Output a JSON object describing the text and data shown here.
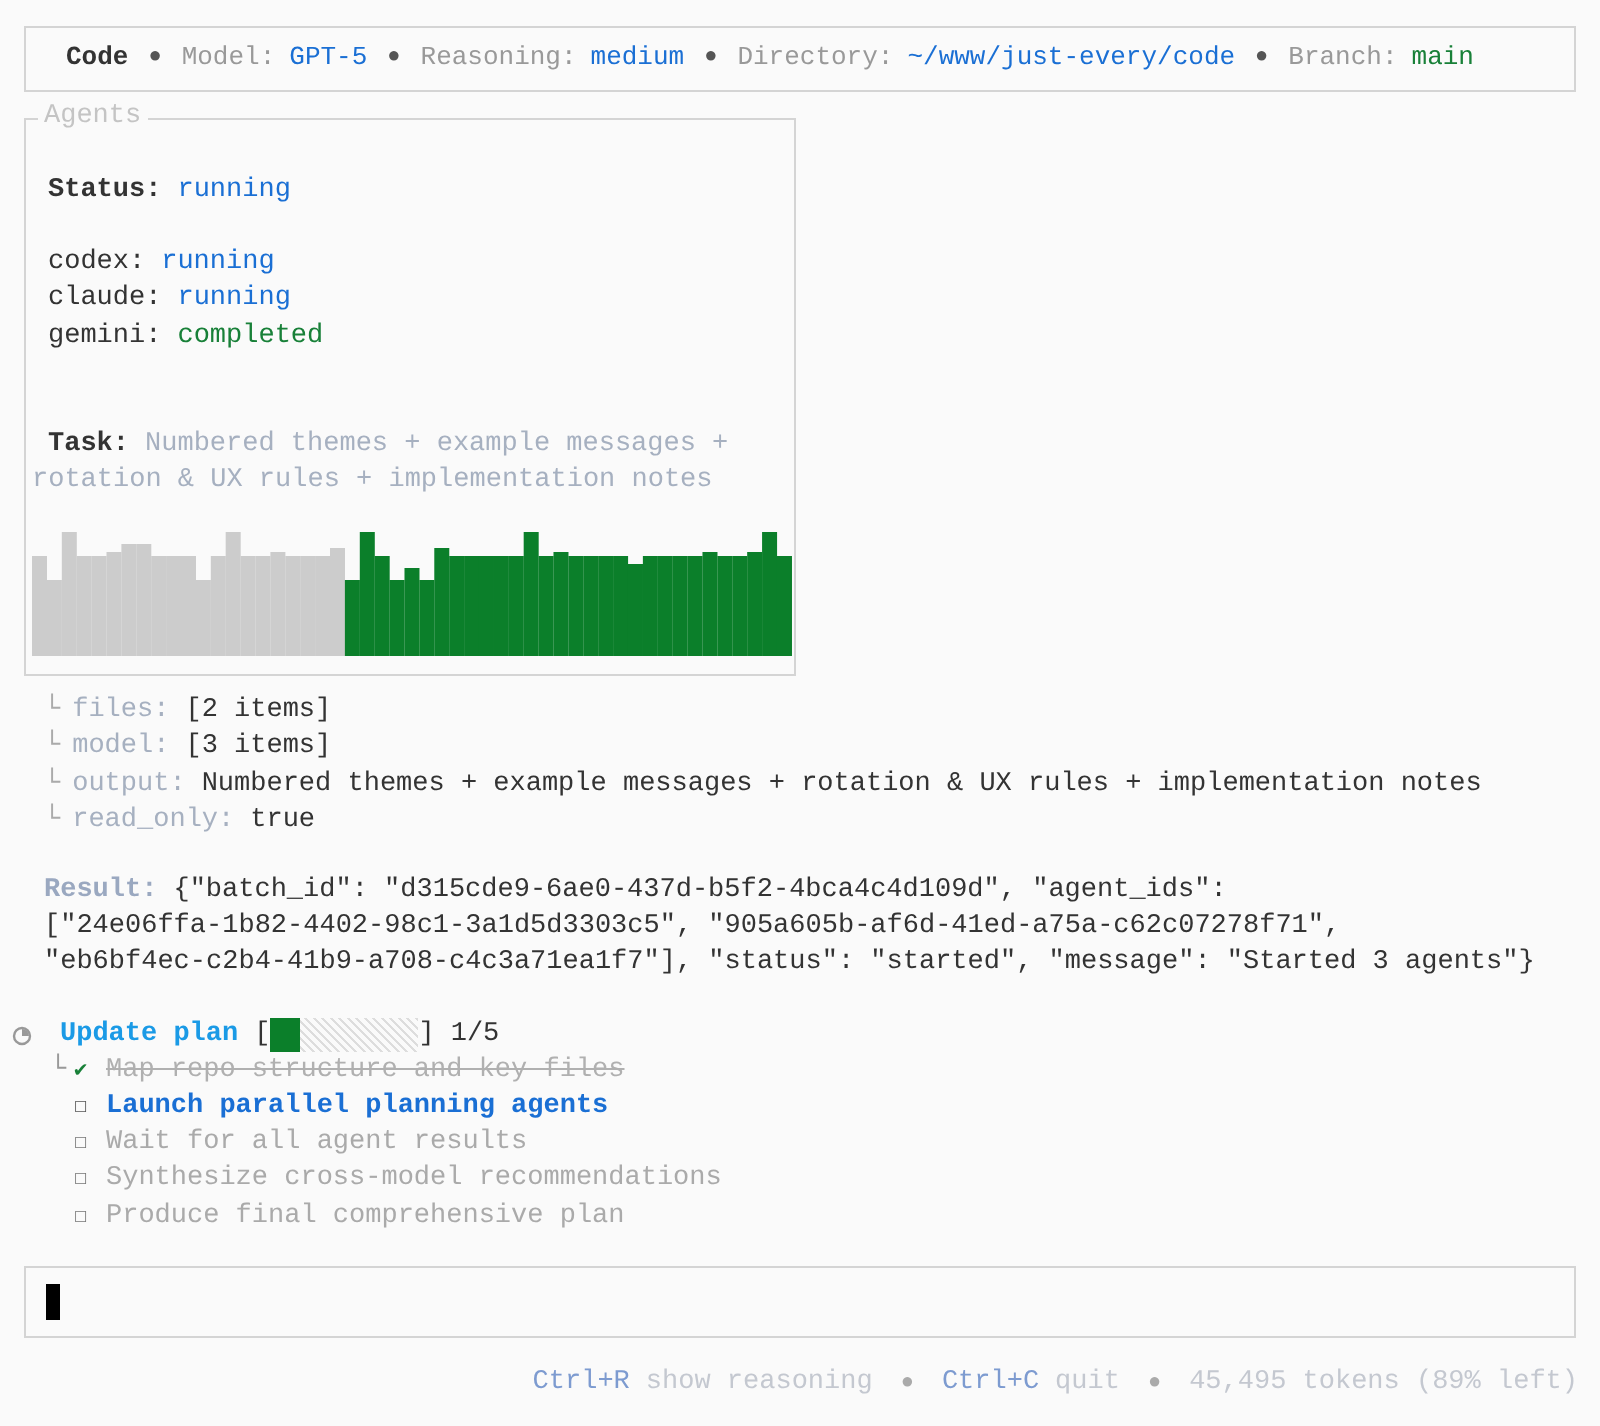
{
  "header": {
    "items": [
      {
        "kind": "title",
        "text": "Code"
      },
      {
        "kind": "bullet",
        "text": "●"
      },
      {
        "kind": "field",
        "label": "Model:",
        "value": "GPT-5",
        "color": "#1a6fd4"
      },
      {
        "kind": "bullet",
        "text": "●"
      },
      {
        "kind": "field",
        "label": "Reasoning:",
        "value": "medium",
        "color": "#1a6fd4"
      },
      {
        "kind": "bullet",
        "text": "●"
      },
      {
        "kind": "field",
        "label": "Directory:",
        "value": "~/www/just-every/code",
        "color": "#1a6fd4"
      },
      {
        "kind": "bullet",
        "text": "●"
      },
      {
        "kind": "field",
        "label": "Branch:",
        "value": "main",
        "color": "#188038"
      }
    ]
  },
  "agents_panel": {
    "title": "Agents",
    "status": {
      "label": "Status:",
      "value": "running",
      "color": "#1a6fd4"
    },
    "agents": [
      {
        "name": "codex:",
        "status": "running",
        "color": "#1a6fd4"
      },
      {
        "name": "claude:",
        "status": "running",
        "color": "#1a6fd4"
      },
      {
        "name": "gemini:",
        "status": "completed",
        "color": "#188038"
      }
    ],
    "task": {
      "label": "Task:",
      "lines": [
        "Numbered themes + example messages +",
        "rotation & UX rules + implementation notes"
      ]
    }
  },
  "params": [
    {
      "branch": "└",
      "key": "files:",
      "value": "[2 items]"
    },
    {
      "branch": "└",
      "key": "model:",
      "value": "[3 items]"
    },
    {
      "branch": "└",
      "key": "output:",
      "value": "Numbered themes + example messages + rotation & UX rules + implementation notes"
    },
    {
      "branch": "└",
      "key": "read_only:",
      "value": "true"
    }
  ],
  "result": {
    "label": "Result:",
    "lines": [
      "{\"batch_id\": \"d315cde9-6ae0-437d-b5f2-4bca4c4d109d\", \"agent_ids\":",
      "[\"24e06ffa-1b82-4402-98c1-3a1d5d3303c5\", \"905a605b-af6d-41ed-a75a-c62c07278f71\",",
      "\"eb6bf4ec-c2b4-41b9-a708-c4c3a71ea1f7\"], \"status\": \"started\", \"message\": \"Started 3 agents\"}"
    ]
  },
  "plan": {
    "title": "Update plan",
    "open_bracket": "[",
    "close_bracket": "]",
    "level": 0.2,
    "count": "1/5",
    "branch": "└",
    "steps": [
      {
        "kind": "done",
        "marker": "✔",
        "text": "Map repo structure and key files"
      },
      {
        "kind": "active",
        "marker": "☐",
        "text": "Launch parallel planning agents"
      },
      {
        "kind": "pending",
        "marker": "☐",
        "text": "Wait for all agent results"
      },
      {
        "kind": "pending",
        "marker": "☐",
        "text": "Synthesize cross-model recommendations"
      },
      {
        "kind": "pending",
        "marker": "☐",
        "text": "Produce final comprehensive plan"
      }
    ]
  },
  "footer": {
    "items": [
      {
        "kind": "key",
        "text": "Ctrl+R"
      },
      {
        "kind": "hint",
        "text": "show reasoning"
      },
      {
        "kind": "bullet",
        "text": "●"
      },
      {
        "kind": "key",
        "text": "Ctrl+C"
      },
      {
        "kind": "hint",
        "text": "quit"
      },
      {
        "kind": "bullet",
        "text": "●"
      },
      {
        "kind": "hint",
        "text": "45,495 tokens (89% left)"
      }
    ]
  }
}
